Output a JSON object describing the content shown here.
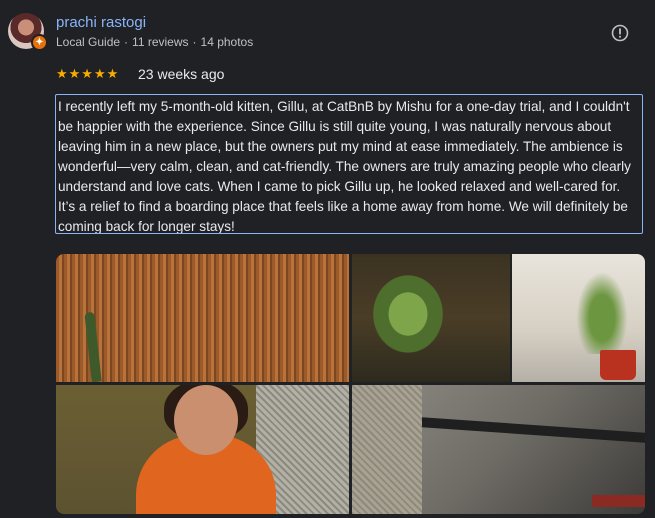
{
  "reviewer": {
    "name": "prachi rastogi",
    "level": "Local Guide",
    "reviews": "11 reviews",
    "photos": "14 photos",
    "separator": "·"
  },
  "review": {
    "stars": "★★★★★",
    "rating": 5,
    "date": "23 weeks ago",
    "text": "I recently left my 5-month-old kitten, Gillu, at CatBnB by Mishu for a one-day trial, and I couldn't be happier with the experience. Since Gillu is still quite young, I was naturally nervous about leaving him in a new place, but the owners put my mind at ease immediately. The ambience is wonderful—very calm, clean, and cat-friendly. The owners are truly amazing people who clearly understand and love cats. When I came to pick Gillu up, he looked relaxed and well-cared for. It’s a relief to find a boarding place that feels like a home away from home. We will definitely be coming back for longer stays!"
  },
  "colors": {
    "background": "#202124",
    "name": "#8ab4f8",
    "stars": "#f9ab00",
    "badge": "#e8710a"
  },
  "icons": {
    "flag": "report-flag-icon",
    "badge": "local-guide-badge-icon"
  }
}
